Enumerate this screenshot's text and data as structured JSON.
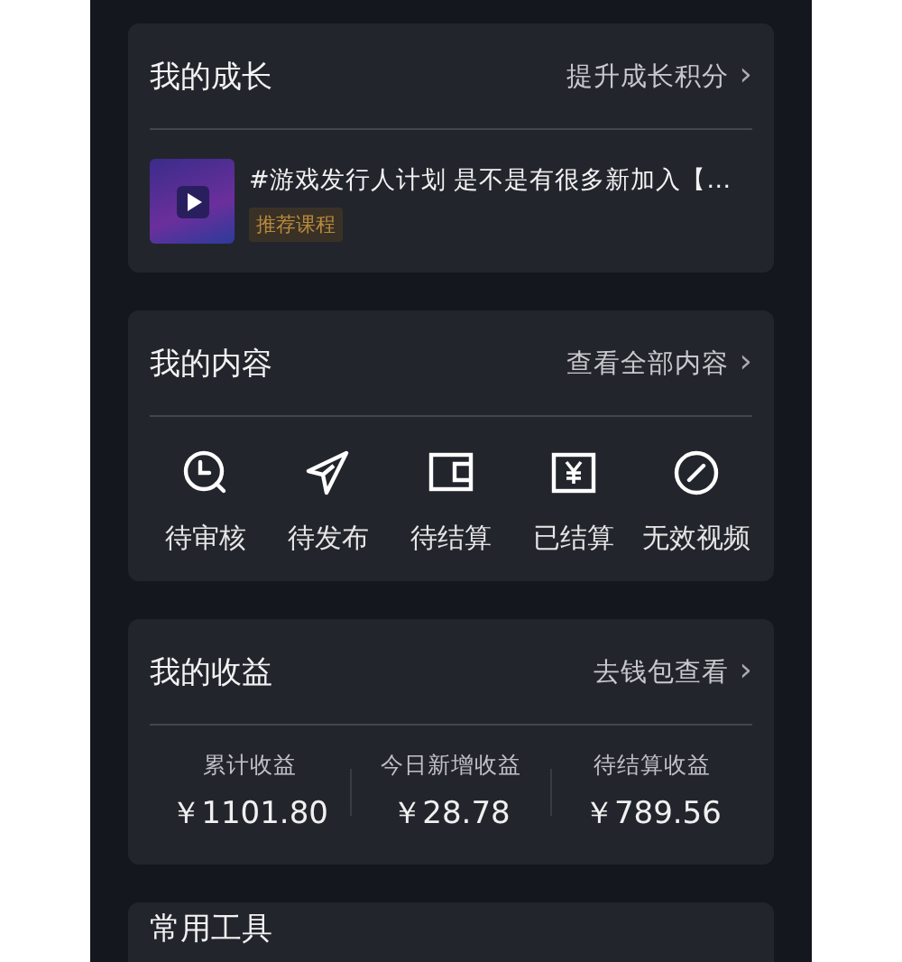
{
  "cards": [
    {
      "kind": "course",
      "title": "我的成长",
      "link": "提升成长积分",
      "chevron": "›",
      "course": {
        "title": "#游戏发行人计划 是不是有很多新加入【…",
        "tag": "推荐课程"
      }
    },
    {
      "kind": "actions",
      "title": "我的内容",
      "link": "查看全部内容",
      "chevron": "›",
      "actions": [
        "待审核",
        "待发布",
        "待结算",
        "已结算",
        "无效视频"
      ]
    },
    {
      "kind": "stats",
      "title": "我的收益",
      "link": "去钱包查看",
      "chevron": "›",
      "stats": [
        {
          "label": "累计收益",
          "value": "￥1101.80"
        },
        {
          "label": "今日新增收益",
          "value": "￥28.78"
        },
        {
          "label": "待结算收益",
          "value": "￥789.56"
        }
      ]
    },
    {
      "kind": "plain",
      "title": "常用工具"
    }
  ]
}
